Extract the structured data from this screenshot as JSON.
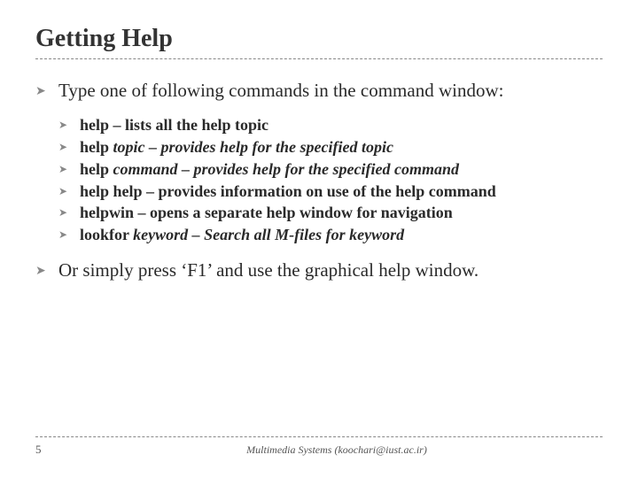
{
  "title": "Getting Help",
  "bullet_glyph": "➤",
  "points": [
    {
      "text": "Type one of following commands in the command window:",
      "subs": [
        {
          "html": "help – lists all the help topic"
        },
        {
          "html": "help <span class='it'>topic – provides help for the specified topic</span>"
        },
        {
          "html": "help <span class='it'>command – provides help for the specified command</span>"
        },
        {
          "html": "help help – provides information on use of the help command"
        },
        {
          "html": "helpwin – opens a separate help window for navigation"
        },
        {
          "html": "lookfor <span class='it'>keyword – Search all M-files for keyword</span>"
        }
      ]
    },
    {
      "text": "Or simply press ‘F1’ and use the graphical help window.",
      "subs": []
    }
  ],
  "footer": {
    "page": "5",
    "text": "Multimedia Systems (koochari@iust.ac.ir)"
  }
}
